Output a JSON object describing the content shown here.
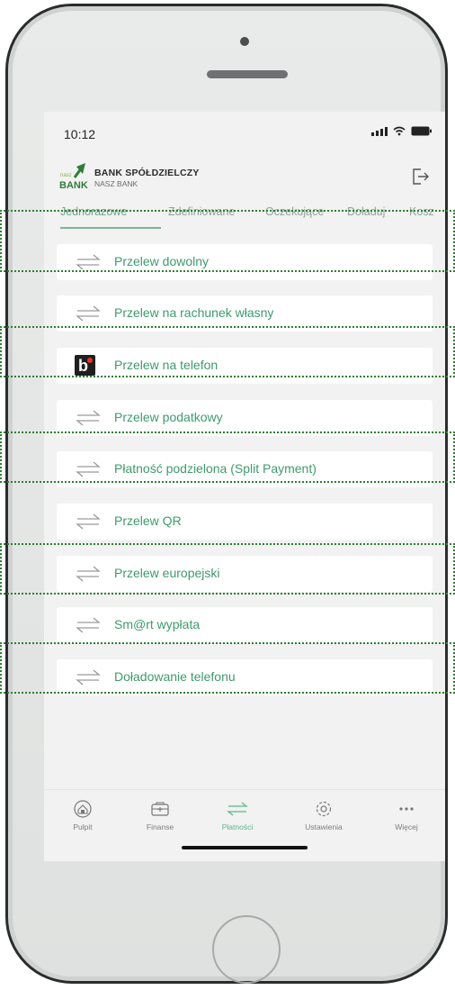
{
  "status_bar": {
    "time": "10:12"
  },
  "bank": {
    "name": "BANK SPÓŁDZIELCZY",
    "subtitle": "NASZ BANK",
    "logo_small": "nasz",
    "logo_word": "BANK"
  },
  "tabs": [
    {
      "label": "Jednorazowe",
      "active": true
    },
    {
      "label": "Zdefiniowane",
      "active": false
    },
    {
      "label": "Oczekujące",
      "active": false
    },
    {
      "label": "Doładuj",
      "active": false
    },
    {
      "label": "Kosz",
      "active": false
    }
  ],
  "payments": [
    {
      "label": "Przelew dowolny",
      "icon": "transfer-arrows-icon"
    },
    {
      "label": "Przelew na rachunek własny",
      "icon": "transfer-arrows-icon"
    },
    {
      "label": "Przelew na telefon",
      "icon": "blik-icon"
    },
    {
      "label": "Przelew podatkowy",
      "icon": "transfer-arrows-icon"
    },
    {
      "label": "Płatność podzielona (Split Payment)",
      "icon": "transfer-arrows-icon"
    },
    {
      "label": "Przelew QR",
      "icon": "transfer-arrows-icon"
    },
    {
      "label": "Przelew europejski",
      "icon": "transfer-arrows-icon"
    },
    {
      "label": "Sm@rt wypłata",
      "icon": "transfer-arrows-icon"
    },
    {
      "label": "Doładowanie telefonu",
      "icon": "transfer-arrows-icon"
    }
  ],
  "bottom_nav": [
    {
      "label": "Pulpit",
      "icon": "home-icon",
      "active": false
    },
    {
      "label": "Finanse",
      "icon": "wallet-icon",
      "active": false
    },
    {
      "label": "Płatności",
      "icon": "transfer-arrows-icon",
      "active": true
    },
    {
      "label": "Ustawienia",
      "icon": "gear-icon",
      "active": false
    },
    {
      "label": "Więcej",
      "icon": "more-dots-icon",
      "active": false
    }
  ],
  "colors": {
    "accent": "#3f9a6e",
    "highlight_border": "#2e7d32",
    "nav_active": "#5fb58d"
  }
}
